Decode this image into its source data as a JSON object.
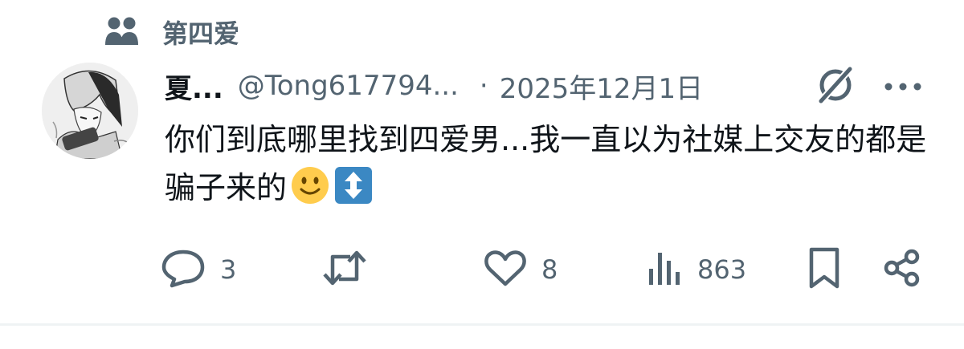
{
  "community": {
    "label": "第四爱",
    "icon": "people-icon"
  },
  "author": {
    "name": "夏...",
    "handle": "@Tong617794...",
    "separator": "·",
    "date": "2025年12月1日"
  },
  "tweet": {
    "text": "你们到底哪里找到四爱男...我一直以为社媒上交友的都是骗子来的",
    "emojis": [
      "slightly-smiling-face",
      "up-down-arrow"
    ]
  },
  "actions": {
    "reply": {
      "icon": "reply-icon",
      "count": "3"
    },
    "repost": {
      "icon": "repost-icon",
      "count": ""
    },
    "like": {
      "icon": "heart-icon",
      "count": "8"
    },
    "views": {
      "icon": "views-icon",
      "count": "863"
    },
    "bookmark": {
      "icon": "bookmark-icon"
    },
    "share": {
      "icon": "share-icon"
    }
  },
  "colors": {
    "text": "#0f1419",
    "secondary": "#536471",
    "divider": "#eff3f4",
    "emoji_arrow": "#3b88c3",
    "emoji_face": "#ffcc4d"
  }
}
